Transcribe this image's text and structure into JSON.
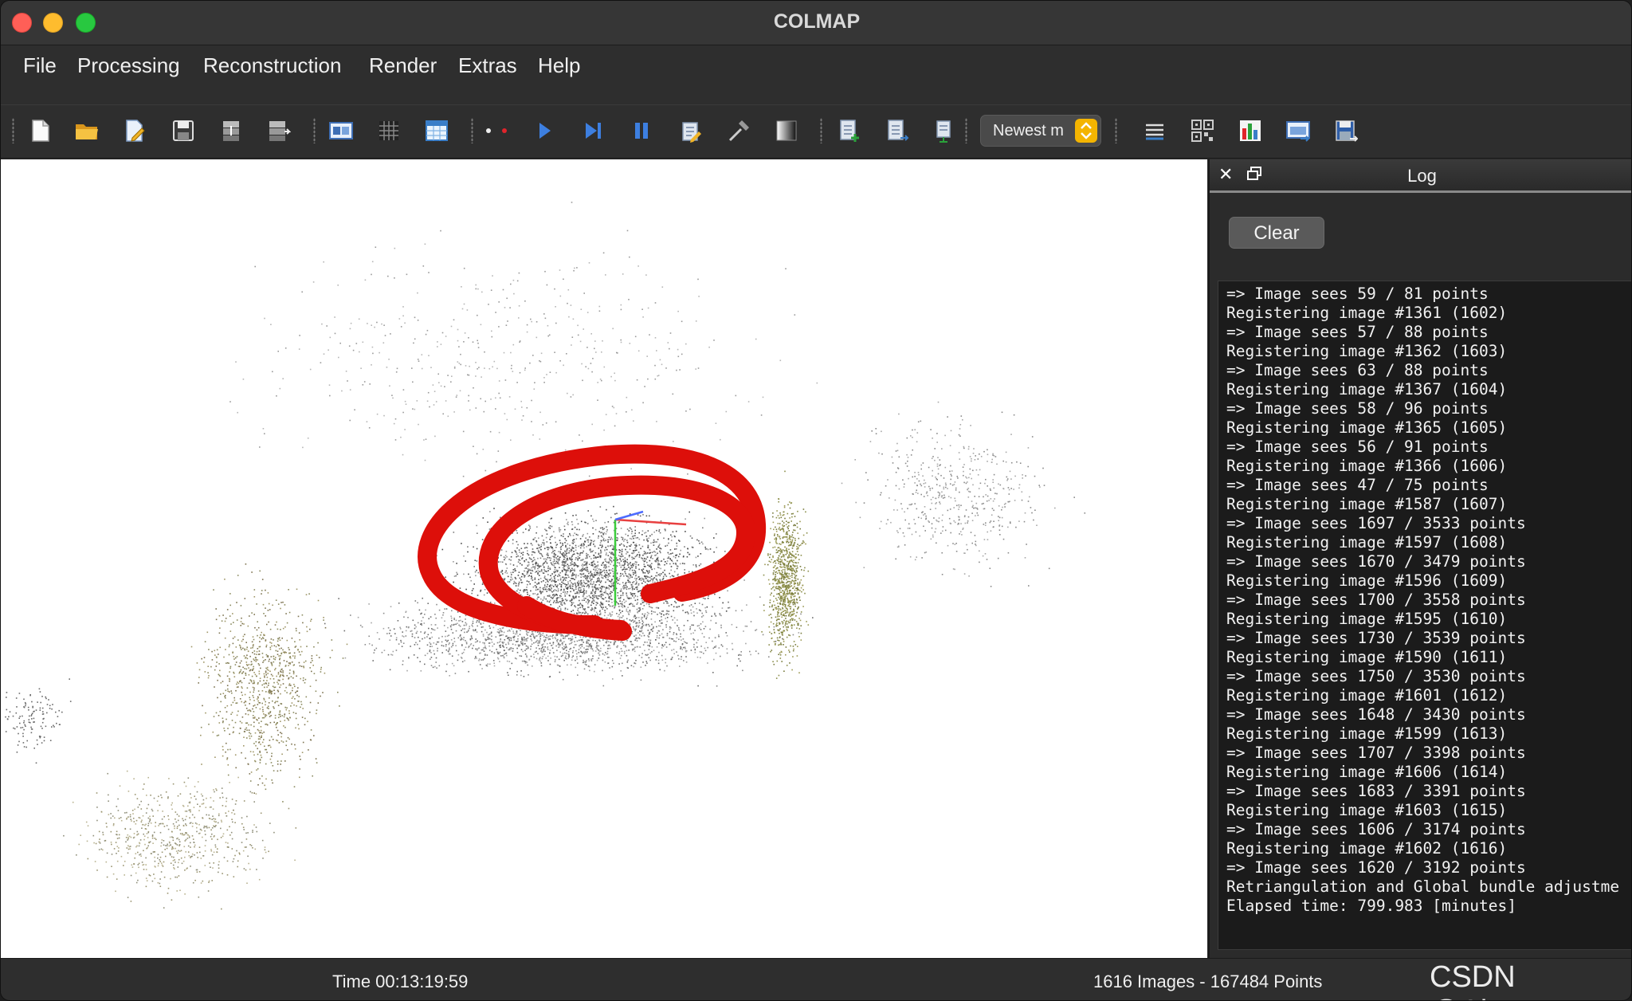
{
  "window": {
    "title": "COLMAP"
  },
  "menu": [
    "File",
    "Processing",
    "Reconstruction",
    "Render",
    "Extras",
    "Help"
  ],
  "toolbar": {
    "icons": [
      "new-project-icon",
      "open-project-icon",
      "edit-project-icon",
      "save-project-icon",
      "import-model-icon",
      "export-model-icon",
      "feature-extraction-icon",
      "feature-matching-icon",
      "database-management-icon",
      "automatic-reconstruction-icon",
      "start-reconstruction-icon",
      "step-reconstruction-icon",
      "pause-reconstruction-icon",
      "reset-reconstruction-icon",
      "bundle-adjustment-icon",
      "dense-reconstruction-icon",
      "render-options-icon",
      "reconstruction-stats-icon",
      "match-matrix-icon",
      "reconstruction-selector",
      "log-icon",
      "grab-image-icon",
      "statistics-icon",
      "grab-movie-icon",
      "render-settings-icon"
    ],
    "reconstruction_selector_label": "Newest m"
  },
  "colors": {
    "annotation": "#dd0f0a",
    "window_bg": "#2b2b2b",
    "viewport_bg": "#ffffff"
  },
  "log": {
    "title": "Log",
    "clear_label": "Clear",
    "lines": [
      "=> Image sees 59 / 81 points",
      "Registering image #1361 (1602)",
      "=> Image sees 57 / 88 points",
      "Registering image #1362 (1603)",
      "=> Image sees 63 / 88 points",
      "Registering image #1367 (1604)",
      "=> Image sees 58 / 96 points",
      "Registering image #1365 (1605)",
      "=> Image sees 56 / 91 points",
      "Registering image #1366 (1606)",
      "=> Image sees 47 / 75 points",
      "Registering image #1587 (1607)",
      "=> Image sees 1697 / 3533 points",
      "Registering image #1597 (1608)",
      "=> Image sees 1670 / 3479 points",
      "Registering image #1596 (1609)",
      "=> Image sees 1700 / 3558 points",
      "Registering image #1595 (1610)",
      "=> Image sees 1730 / 3539 points",
      "Registering image #1590 (1611)",
      "=> Image sees 1750 / 3530 points",
      "Registering image #1601 (1612)",
      "=> Image sees 1648 / 3430 points",
      "Registering image #1599 (1613)",
      "=> Image sees 1707 / 3398 points",
      "Registering image #1606 (1614)",
      "=> Image sees 1683 / 3391 points",
      "Registering image #1603 (1615)",
      "=> Image sees 1606 / 3174 points",
      "Registering image #1602 (1616)",
      "=> Image sees 1620 / 3192 points",
      "Retriangulation and Global bundle adjustme",
      "Elapsed time: 799.983 [minutes]"
    ]
  },
  "status": {
    "time": "Time 00:13:19:59",
    "counts": "1616 Images - 167484 Points"
  },
  "watermark": "CSDN @Ajaxm"
}
